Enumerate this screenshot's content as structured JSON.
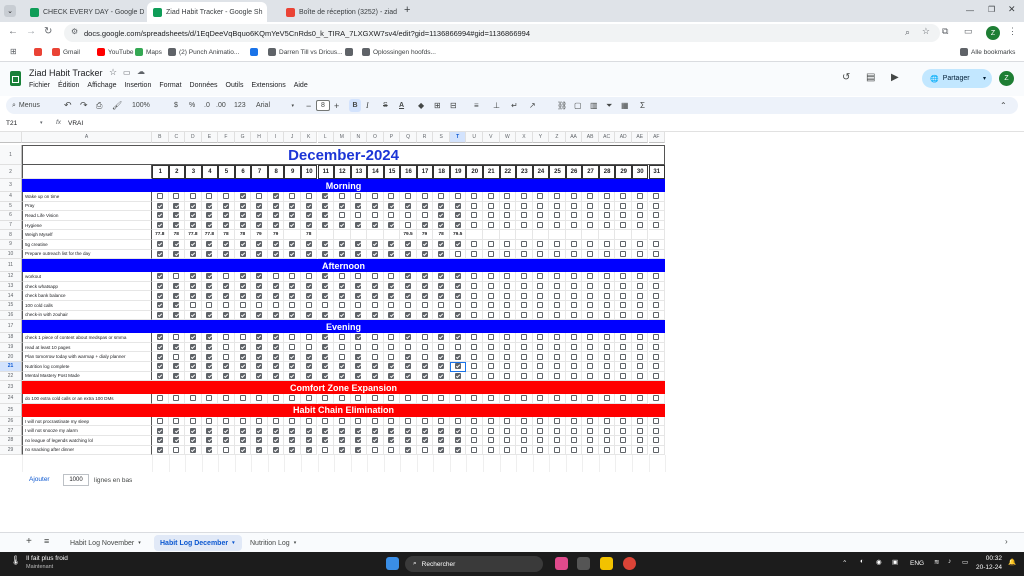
{
  "browser": {
    "tabs": [
      {
        "title": "CHECK EVERY DAY - Google Do",
        "color": "#0f9d58",
        "active": false
      },
      {
        "title": "Ziad Habit Tracker - Google Sh",
        "color": "#0f9d58",
        "active": true
      },
      {
        "title": "Boîte de réception (3252) - ziad",
        "color": "#ea4335",
        "active": false
      }
    ],
    "new_tab": "+",
    "url": "docs.google.com/spreadsheets/d/1EqDeeVqBquo6KQmYeV5CnRds0_k_TIRA_7LXGXW7sv4/edit?gid=1136866994#gid=1136866994",
    "profile_initial": "Z",
    "bookmarks": [
      {
        "label": "",
        "color": "#ea4335"
      },
      {
        "label": "Gmail",
        "color": "#ea4335"
      },
      {
        "label": "YouTube",
        "color": "#ff0000"
      },
      {
        "label": "Maps",
        "color": "#34a853"
      },
      {
        "label": "(2) Punch Animatio...",
        "color": "#5f6368"
      },
      {
        "label": "",
        "color": "#1a73e8"
      },
      {
        "label": "Darren Till vs Dricus...",
        "color": "#5f6368"
      },
      {
        "label": "",
        "color": "#5f6368"
      },
      {
        "label": "Oplossingen hoofds...",
        "color": "#5f6368"
      }
    ],
    "all_bookmarks": "Alle bookmarks"
  },
  "doc": {
    "title": "Ziad Habit Tracker",
    "menus": [
      "Fichier",
      "Édition",
      "Affichage",
      "Insertion",
      "Format",
      "Données",
      "Outils",
      "Extensions",
      "Aide"
    ],
    "share_label": "Partager",
    "profile_initial": "Z"
  },
  "toolbar": {
    "menus_label": "Menus",
    "zoom": "100%",
    "currency": "$",
    "percent": "%",
    "dec_less": ".0",
    "dec_more": ".00",
    "num_format": "123",
    "font": "Arial",
    "font_size": "8",
    "bold": "B",
    "italic": "I",
    "strike": "S",
    "textcolor": "A"
  },
  "formula": {
    "cell_ref": "T21",
    "fx": "fx",
    "value": "VRAI"
  },
  "sheet": {
    "columns": [
      "A",
      "B",
      "C",
      "D",
      "E",
      "F",
      "G",
      "H",
      "I",
      "J",
      "K",
      "L",
      "M",
      "N",
      "O",
      "P",
      "Q",
      "R",
      "S",
      "T",
      "U",
      "V",
      "W",
      "X",
      "Y",
      "Z",
      "AA",
      "AB",
      "AC",
      "AD",
      "AE",
      "AF"
    ],
    "rows": [
      "1",
      "2",
      "3",
      "4",
      "5",
      "6",
      "7",
      "8",
      "9",
      "10",
      "11",
      "12",
      "13",
      "14",
      "15",
      "16",
      "17",
      "18",
      "19",
      "20",
      "21",
      "22",
      "23",
      "24",
      "25",
      "26",
      "27",
      "28",
      "29"
    ],
    "title": "December-2024",
    "days": [
      "1",
      "2",
      "3",
      "4",
      "5",
      "6",
      "7",
      "8",
      "9",
      "10",
      "11",
      "12",
      "13",
      "14",
      "15",
      "16",
      "17",
      "18",
      "19",
      "20",
      "21",
      "22",
      "23",
      "24",
      "25",
      "26",
      "27",
      "28",
      "29",
      "30",
      "31"
    ],
    "sections": {
      "morning": "Morning",
      "afternoon": "Afternoon",
      "evening": "Evening",
      "comfort": "Comfort Zone Expansion",
      "chain": "Habit Chain Elimination"
    },
    "colors": {
      "blue_band": "#0000ff",
      "red_band": "#ff0000",
      "title_text": "#1c35d6"
    },
    "morning": [
      {
        "label": "Wake up on time",
        "checks": "0000010100100000000000000000000"
      },
      {
        "label": "Pray",
        "checks": "1111111111111111111000000000000"
      },
      {
        "label": "Read Life Vision",
        "checks": "1111111111100000011000000000000"
      },
      {
        "label": "Hygiene",
        "checks": "1111111111111110111000000000000"
      },
      {
        "label": "Weigh Myself",
        "weights": [
          "77.8",
          "78",
          "77.8",
          "77.8",
          "78",
          "78",
          "79",
          "79",
          "",
          "78",
          "",
          "",
          "",
          "",
          "",
          "79.5",
          "79",
          "78",
          "79.5",
          "",
          "",
          "",
          "",
          "",
          "",
          "",
          "",
          "",
          "",
          "",
          ""
        ]
      },
      {
        "label": "5g creatine",
        "checks": "1111111111111111111000000000000"
      },
      {
        "label": "Prepare outreach list for the day",
        "checks": "1111111111111111110000000000000"
      }
    ],
    "afternoon": [
      {
        "label": "workout",
        "checks": "1011011000100001111000000000000"
      },
      {
        "label": "check whatsapp",
        "checks": "1111111111111111111000000000000"
      },
      {
        "label": "check bank balance",
        "checks": "1111111111111111111000000000000"
      },
      {
        "label": "100 cold calls",
        "checks": "1100000000000000000000000000000"
      },
      {
        "label": "check-in with zouhair",
        "checks": "1111111111111111111000000000000"
      }
    ],
    "evening": [
      {
        "label": "check 1 piece of content about medspas or smma",
        "checks": "1011001100101001011000000000000"
      },
      {
        "label": "read at least 10 pages",
        "checks": "1111011100100000000000000000000"
      },
      {
        "label": "Plan tomorrow today with warmap + dialy planner",
        "checks": "1011011111101001011000000000000"
      },
      {
        "label": "Nutrition log complete",
        "checks": "1111111111111111111000000000000"
      },
      {
        "label": "Mental Mastery Post Made",
        "checks": "1111111111111111111000000000000"
      }
    ],
    "comfort": [
      {
        "label": "do 100 extra cold calls or an extra 100 DMs",
        "checks": "0000000000000000000000000000000"
      }
    ],
    "chain": [
      {
        "label": "I will not procrastinate my sleep",
        "checks": "0000000000000000000000000000000"
      },
      {
        "label": "I will not snooze my alarm",
        "checks": "1111111111111111111000000000000"
      },
      {
        "label": "no league of legends watching lol",
        "checks": "1111111111111111111000000000000"
      },
      {
        "label": "no snacking after dinner",
        "checks": "1011011111011001011000000000000"
      }
    ],
    "add_label": "Ajouter",
    "add_count": "1000",
    "add_suffix": "lignes en bas"
  },
  "sheet_tabs": [
    {
      "label": "Habit Log November",
      "active": false
    },
    {
      "label": "Habit Log December",
      "active": true
    },
    {
      "label": "Nutrition Log",
      "active": false
    }
  ],
  "taskbar": {
    "weather": "Il fait plus froid",
    "weather_sub": "Maintenant",
    "search": "Rechercher",
    "lang": "ENG",
    "time": "00:32",
    "date": "20-12-24"
  }
}
